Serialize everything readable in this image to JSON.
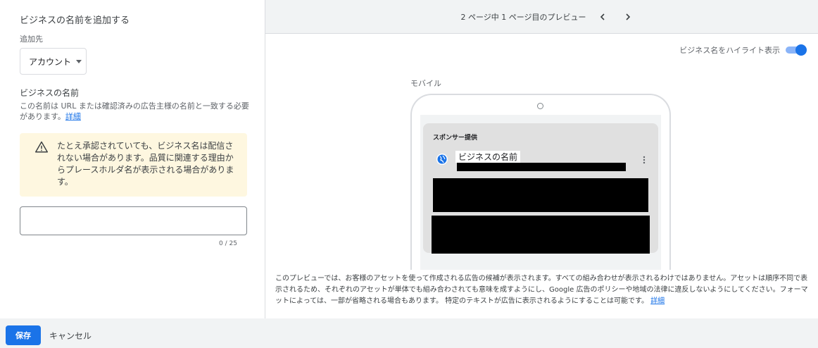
{
  "left": {
    "title": "ビジネスの名前を追加する",
    "destination_label": "追加先",
    "destination_value": "アカウント",
    "business_name_label": "ビジネスの名前",
    "business_name_description": "この名前は URL または確認済みの広告主様の名前と一致する必要があります。",
    "details_link": "詳細",
    "warning_text": "たとえ承認されていても、ビジネス名は配信されない場合があります。品質に関連する理由からプレースホルダ名が表示される場合があります。",
    "input_value": "",
    "char_counter": "0 / 25"
  },
  "preview": {
    "pager_text": "2 ページ中 1 ページ目のプレビュー",
    "prev_icon": "chevron-left-icon",
    "next_icon": "chevron-right-icon",
    "highlight_label": "ビジネス名をハイライト表示",
    "highlight_on": true,
    "mobile_label": "モバイル",
    "sponsored_label": "スポンサー提供",
    "ad_business_name": "ビジネスの名前",
    "disclaimer": "このプレビューでは、お客様のアセットを使って作成される広告の候補が表示されます。すべての組み合わせが表示されるわけではありません。アセットは順序不同で表示されるため、それぞれのアセットが単体でも組み合わされても意味を成すようにし、Google 広告のポリシーや地域の法律に違反しないようにしてください。フォーマットによっては、一部が省略される場合もあります。 特定のテキストが広告に表示されるようにすることは可能です。",
    "disclaimer_link": "詳細"
  },
  "footer": {
    "save_label": "保存",
    "cancel_label": "キャンセル"
  },
  "colors": {
    "primary": "#1a73e8",
    "warning_bg": "#fef7e0",
    "header_bg": "#f1f3f4"
  }
}
